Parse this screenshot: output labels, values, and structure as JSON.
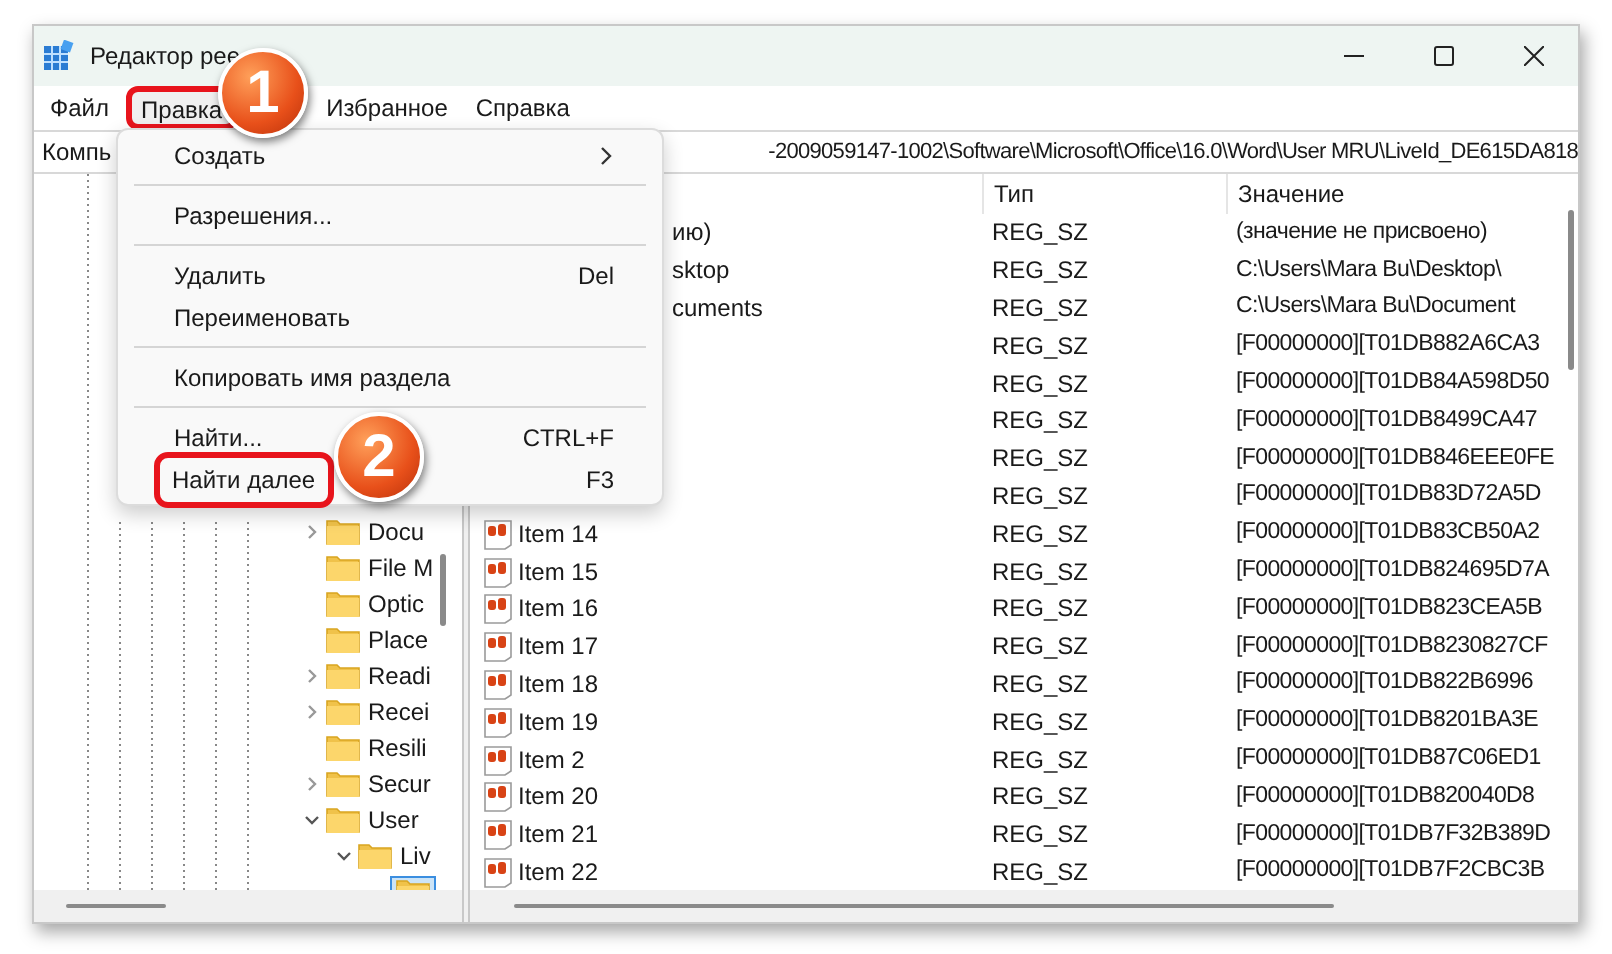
{
  "window": {
    "title": "Редактор рее"
  },
  "menu_bar": [
    {
      "label": "Файл",
      "selected": false
    },
    {
      "label": "Правка",
      "selected": true
    },
    {
      "label": "Избранное",
      "selected": false
    },
    {
      "label": "Справка",
      "selected": false
    }
  ],
  "address_bar": {
    "start": "Компь",
    "end": "-2009059147-1002\\Software\\Microsoft\\Office\\16.0\\Word\\User MRU\\LiveId_DE615DA818"
  },
  "dropdown": [
    {
      "kind": "item",
      "label": "Создать",
      "submenu": true,
      "highlighted": false
    },
    {
      "kind": "separator"
    },
    {
      "kind": "item",
      "label": "Разрешения...",
      "submenu": false,
      "highlighted": false
    },
    {
      "kind": "separator"
    },
    {
      "kind": "item",
      "label": "Удалить",
      "shortcut": "Del",
      "submenu": false,
      "highlighted": false
    },
    {
      "kind": "item",
      "label": "Переименовать",
      "submenu": false,
      "highlighted": false
    },
    {
      "kind": "separator"
    },
    {
      "kind": "item",
      "label": "Копировать имя раздела",
      "submenu": false,
      "highlighted": false
    },
    {
      "kind": "separator"
    },
    {
      "kind": "item",
      "label": "Найти...",
      "shortcut": "CTRL+F",
      "submenu": false,
      "highlighted": false
    },
    {
      "kind": "item",
      "label": "Найти далее",
      "shortcut": "F3",
      "submenu": false,
      "highlighted": true
    }
  ],
  "callouts": [
    {
      "number": "1"
    },
    {
      "number": "2"
    }
  ],
  "tree": [
    {
      "name": "Docu",
      "expanded": false
    },
    {
      "name": "File M"
    },
    {
      "name": "Optic"
    },
    {
      "name": "Place"
    },
    {
      "name": "Readi",
      "expanded": false
    },
    {
      "name": "Recei",
      "expanded": false
    },
    {
      "name": "Resili"
    },
    {
      "name": "Secur",
      "expanded": false
    },
    {
      "name": "User",
      "expanded": true,
      "children": [
        {
          "name": "Liv",
          "expanded": true,
          "children": [
            {
              "selected": true
            }
          ]
        }
      ]
    }
  ],
  "table": {
    "columns": [
      "Тип",
      "Значение"
    ],
    "rows": [
      {
        "kind": "partial",
        "name": "ию)",
        "type": "REG_SZ",
        "value": "(значение не присвоено)"
      },
      {
        "kind": "partial",
        "name": "sktop",
        "type": "REG_SZ",
        "value": "C:\\Users\\Mara Bu\\Desktop\\"
      },
      {
        "kind": "partial",
        "name": "cuments",
        "type": "REG_SZ",
        "value": "C:\\Users\\Mara Bu\\Document"
      },
      {
        "kind": "partial",
        "type": "REG_SZ",
        "value": "[F00000000][T01DB882A6CA3"
      },
      {
        "kind": "partial",
        "type": "REG_SZ",
        "value": "[F00000000][T01DB84A598D50"
      },
      {
        "kind": "partial",
        "type": "REG_SZ",
        "value": "[F00000000][T01DB8499CA47"
      },
      {
        "kind": "partial",
        "type": "REG_SZ",
        "value": "[F00000000][T01DB846EEE0FE"
      },
      {
        "kind": "partial",
        "type": "REG_SZ",
        "value": "[F00000000][T01DB83D72A5D"
      },
      {
        "kind": "full",
        "name": "Item 14",
        "type": "REG_SZ",
        "value": "[F00000000][T01DB83CB50A2"
      },
      {
        "kind": "full",
        "name": "Item 15",
        "type": "REG_SZ",
        "value": "[F00000000][T01DB824695D7A"
      },
      {
        "kind": "full",
        "name": "Item 16",
        "type": "REG_SZ",
        "value": "[F00000000][T01DB823CEA5B"
      },
      {
        "kind": "full",
        "name": "Item 17",
        "type": "REG_SZ",
        "value": "[F00000000][T01DB8230827CF"
      },
      {
        "kind": "full",
        "name": "Item 18",
        "type": "REG_SZ",
        "value": "[F00000000][T01DB822B6996"
      },
      {
        "kind": "full",
        "name": "Item 19",
        "type": "REG_SZ",
        "value": "[F00000000][T01DB8201BA3E"
      },
      {
        "kind": "full",
        "name": "Item 2",
        "type": "REG_SZ",
        "value": "[F00000000][T01DB87C06ED1"
      },
      {
        "kind": "full",
        "name": "Item 20",
        "type": "REG_SZ",
        "value": "[F00000000][T01DB820040D8"
      },
      {
        "kind": "full",
        "name": "Item 21",
        "type": "REG_SZ",
        "value": "[F00000000][T01DB7F32B389D"
      },
      {
        "kind": "full",
        "name": "Item 22",
        "type": "REG_SZ",
        "value": "[F00000000][T01DB7F2CBC3B"
      }
    ]
  }
}
